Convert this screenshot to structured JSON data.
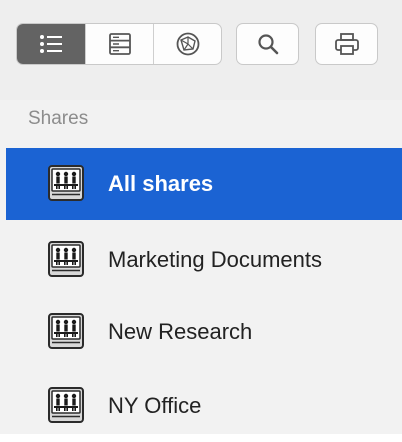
{
  "toolbar": {
    "view_segments": [
      {
        "icon": "list-view-icon",
        "selected": true
      },
      {
        "icon": "column-view-icon",
        "selected": false
      },
      {
        "icon": "network-view-icon",
        "selected": false
      }
    ],
    "search_icon": "search-icon",
    "print_icon": "print-icon"
  },
  "sidebar": {
    "section_title": "Shares",
    "items": [
      {
        "label": "All shares",
        "icon": "network-share-icon",
        "selected": true
      },
      {
        "label": "Marketing Documents",
        "icon": "network-share-icon",
        "selected": false
      },
      {
        "label": "New Research",
        "icon": "network-share-icon",
        "selected": false
      },
      {
        "label": "NY Office",
        "icon": "network-share-icon",
        "selected": false
      }
    ]
  },
  "colors": {
    "toolbar_bg": "#eeeeee",
    "sidebar_bg": "#f2f2f2",
    "selection": "#1b63d3",
    "active_segment": "#636363",
    "section_header": "#8c8c8c"
  }
}
